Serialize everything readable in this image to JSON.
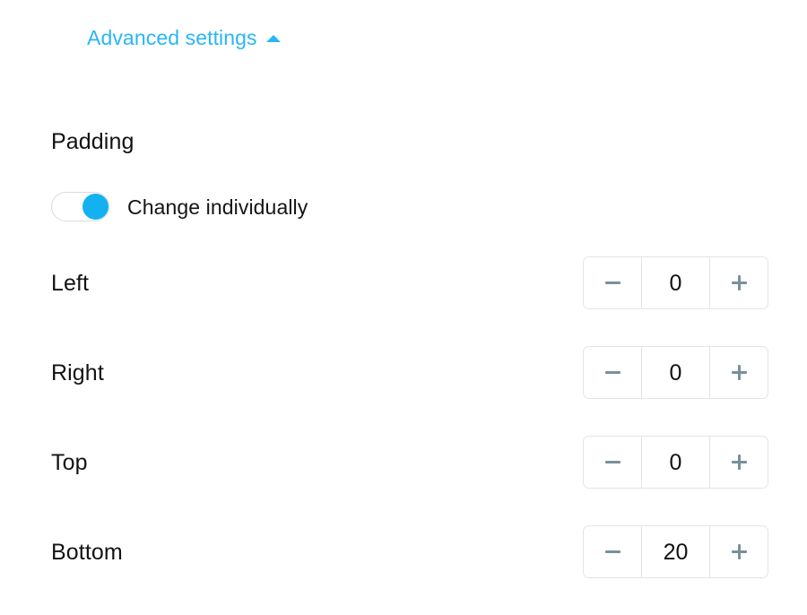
{
  "colors": {
    "accent": "#29b6f6",
    "toggle_on": "#14b1f0",
    "stepper_glyph": "#78909c",
    "border": "#e2e4e6",
    "text": "#121212",
    "background": "#ffffff"
  },
  "disclosure": {
    "label": "Advanced settings",
    "icon": "chevron-up-icon",
    "expanded": true
  },
  "section": {
    "heading": "Padding",
    "toggle": {
      "label": "Change individually",
      "state": "on"
    },
    "stepper_icons": {
      "decrement": "minus-icon",
      "increment": "plus-icon"
    },
    "rows": [
      {
        "label": "Left",
        "value": "0"
      },
      {
        "label": "Right",
        "value": "0"
      },
      {
        "label": "Top",
        "value": "0"
      },
      {
        "label": "Bottom",
        "value": "20"
      }
    ]
  }
}
